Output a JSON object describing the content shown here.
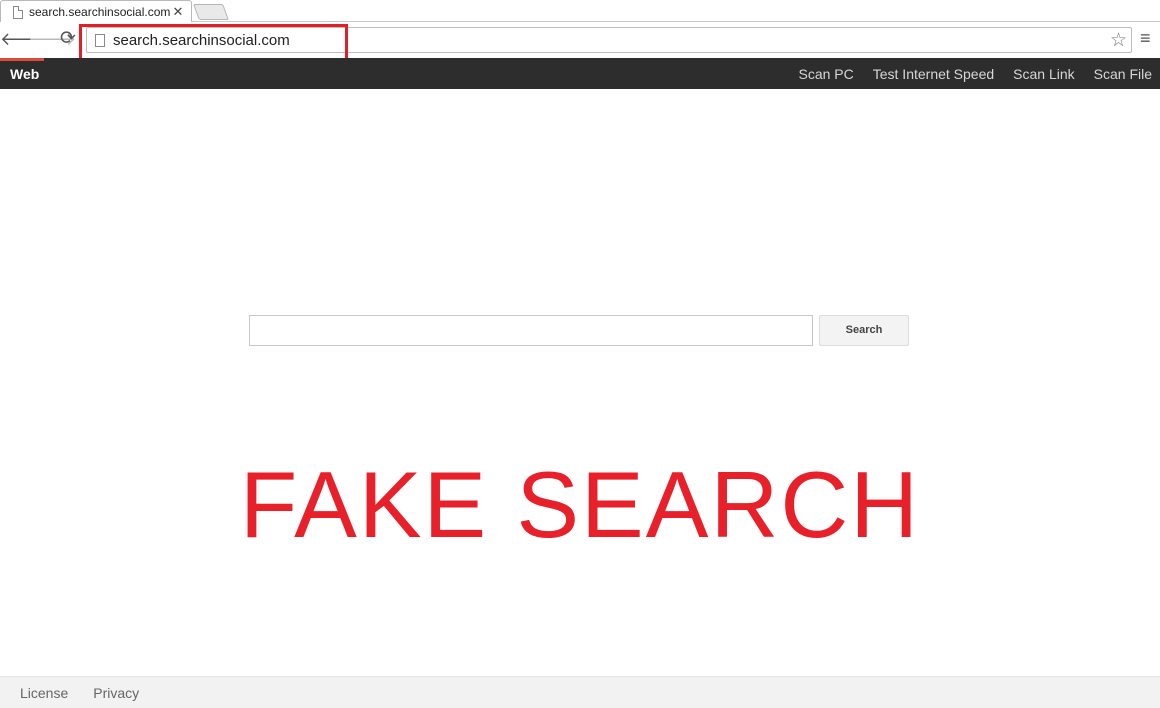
{
  "browser": {
    "tab_title": "search.searchinsocial.com",
    "tab_close": "✕",
    "url": "search.searchinsocial.com",
    "back_icon": "🡐",
    "forward_icon": "🡒",
    "reload_icon": "⟳",
    "star_icon": "☆",
    "menu_icon": "≡"
  },
  "nav": {
    "web_label": "Web",
    "links": [
      "Scan PC",
      "Test Internet Speed",
      "Scan Link",
      "Scan File"
    ]
  },
  "search": {
    "button_label": "Search",
    "input_value": ""
  },
  "overlay": {
    "label": "FAKE SEARCH",
    "color": "#e8202a"
  },
  "footer": {
    "links": [
      "License",
      "Privacy"
    ]
  }
}
